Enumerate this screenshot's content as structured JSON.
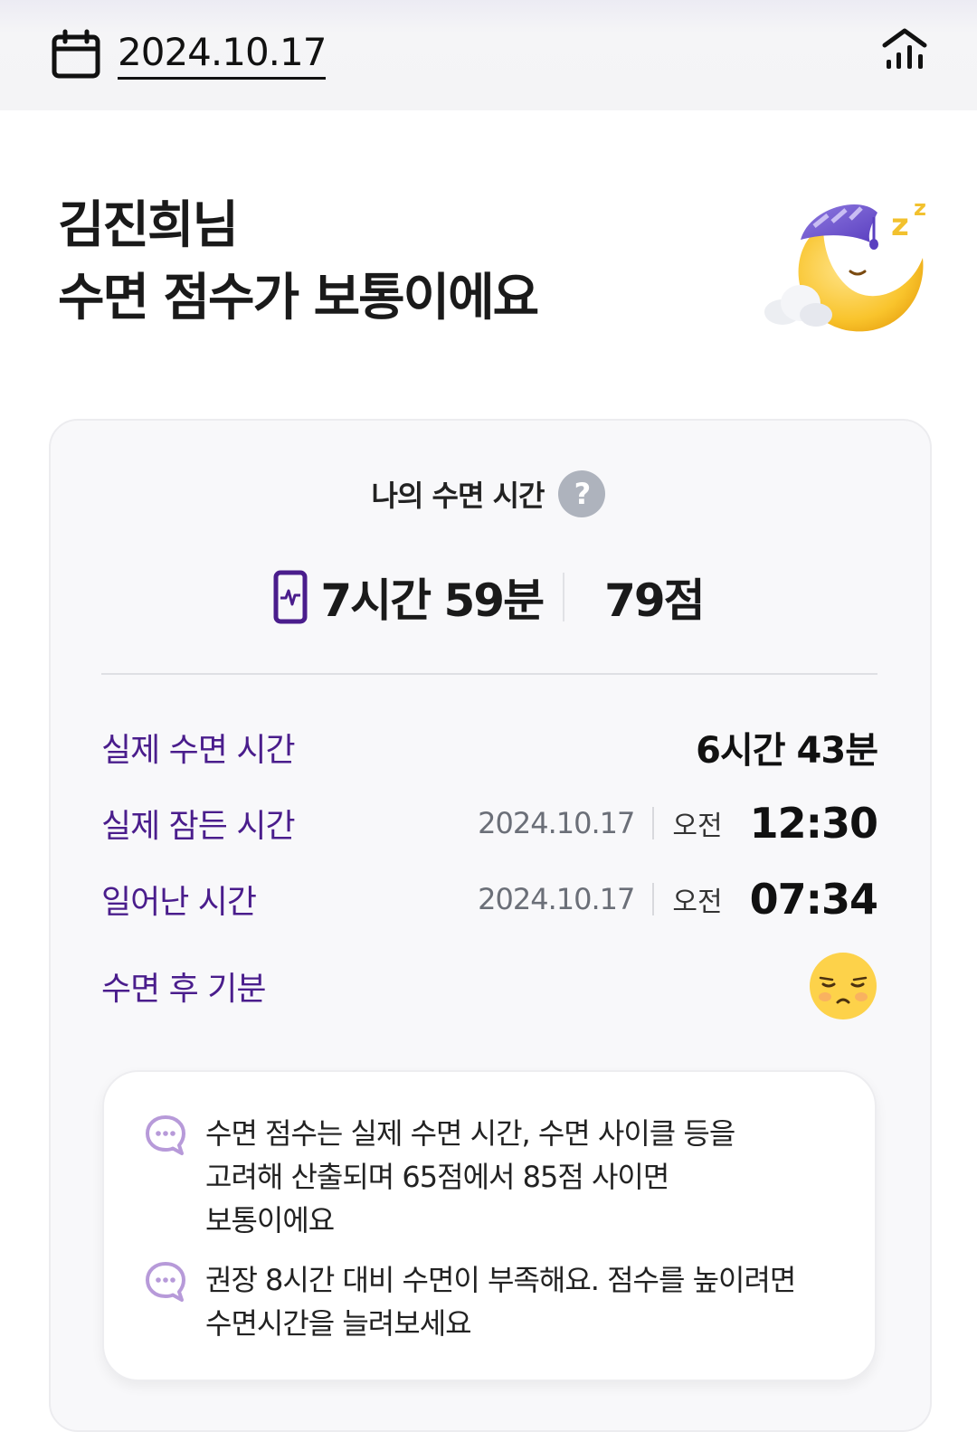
{
  "header": {
    "date": "2024.10.17",
    "calendar_icon": "calendar-icon",
    "chart_icon": "bar-chart-icon"
  },
  "headline": {
    "name": "김진희님",
    "message": "수면 점수가 보통이에요",
    "illustration": "sleeping-moon-illustration"
  },
  "card": {
    "title": "나의 수면 시간",
    "help_icon_glyph": "?",
    "summary": {
      "duration": "7시간 59분",
      "score": "79점",
      "device_icon": "phone-heartbeat-icon"
    },
    "rows": [
      {
        "label": "실제 수면 시간",
        "value": "6시간 43분"
      },
      {
        "label": "실제 잠든 시간",
        "date": "2024.10.17",
        "ampm": "오전",
        "time": "12:30"
      },
      {
        "label": "일어난 시간",
        "date": "2024.10.17",
        "ampm": "오전",
        "time": "07:34"
      },
      {
        "label": "수면 후 기분",
        "mood_icon": "sleepy-face-icon"
      }
    ],
    "notes": [
      "수면 점수는 실제 수면 시간, 수면 사이클 등을\n고려해 산출되며 65점에서 85점 사이면\n보통이에요",
      "권장 8시간 대비 수면이 부족해요. 점수를 높이려면\n수면시간을 늘려보세요"
    ]
  },
  "colors": {
    "accent_purple": "#4a1d8c",
    "note_icon_purple": "#b79ad9",
    "mood_yellow": "#fdd24a"
  }
}
